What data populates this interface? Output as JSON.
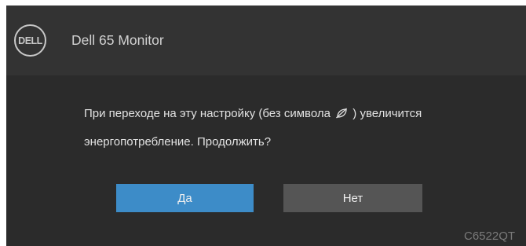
{
  "header": {
    "logo_text": "DELL",
    "title": "Dell 65 Monitor"
  },
  "message": {
    "line1_before": "При переходе на эту настройку (без символа",
    "symbol_icon": "energy-saving-icon",
    "line1_after": ") увеличится",
    "line2": "энергопотребление. Продолжить?"
  },
  "buttons": {
    "yes_label": "Да",
    "no_label": "Нет"
  },
  "footer": {
    "model_code": "C6522QT"
  },
  "colors": {
    "dialog_bg": "#2b2b2b",
    "header_bg": "#333333",
    "yes_button": "#3d8cc8",
    "no_button": "#555555"
  }
}
